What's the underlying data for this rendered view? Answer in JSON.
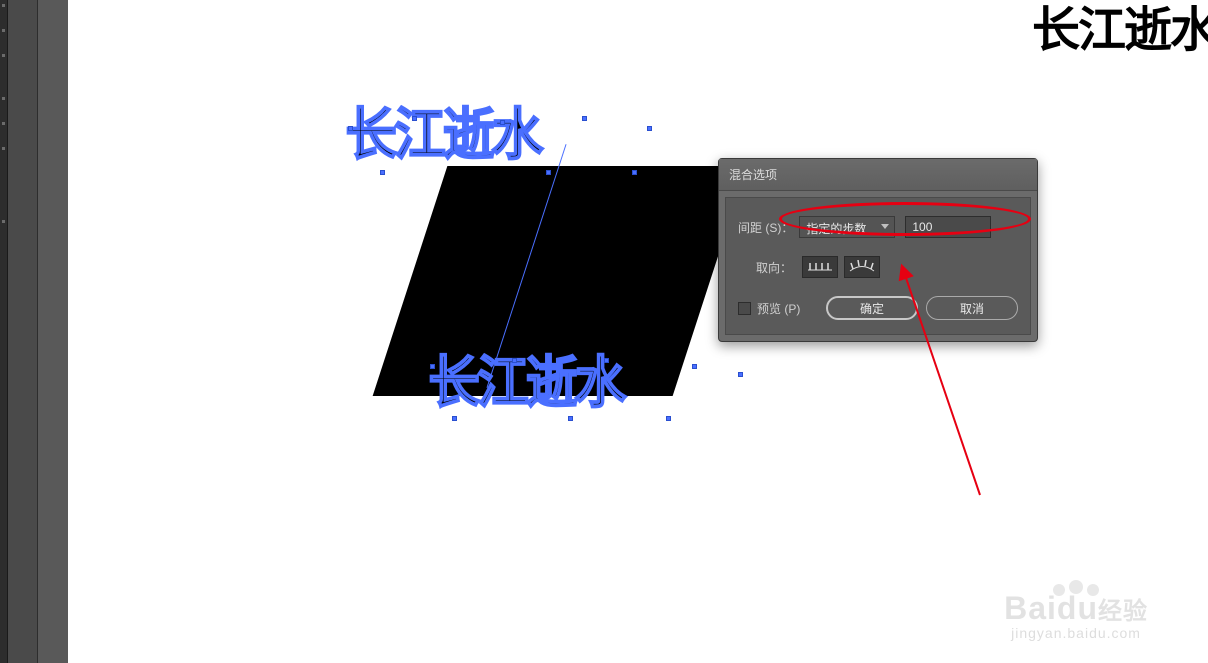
{
  "canvas": {
    "corner_text": "长江逝水",
    "blend_text_top": "长江逝水",
    "blend_text_bottom": "长江逝水"
  },
  "dialog": {
    "title": "混合选项",
    "spacing_label": "间距 (S)：",
    "spacing_mode": "指定的步数",
    "spacing_value": "100",
    "orientation_label": "取向：",
    "preview_label": "预览 (P)",
    "ok": "确定",
    "cancel": "取消"
  },
  "watermark": {
    "brand": "Baidu",
    "suffix": "经验",
    "url": "jingyan.baidu.com"
  }
}
